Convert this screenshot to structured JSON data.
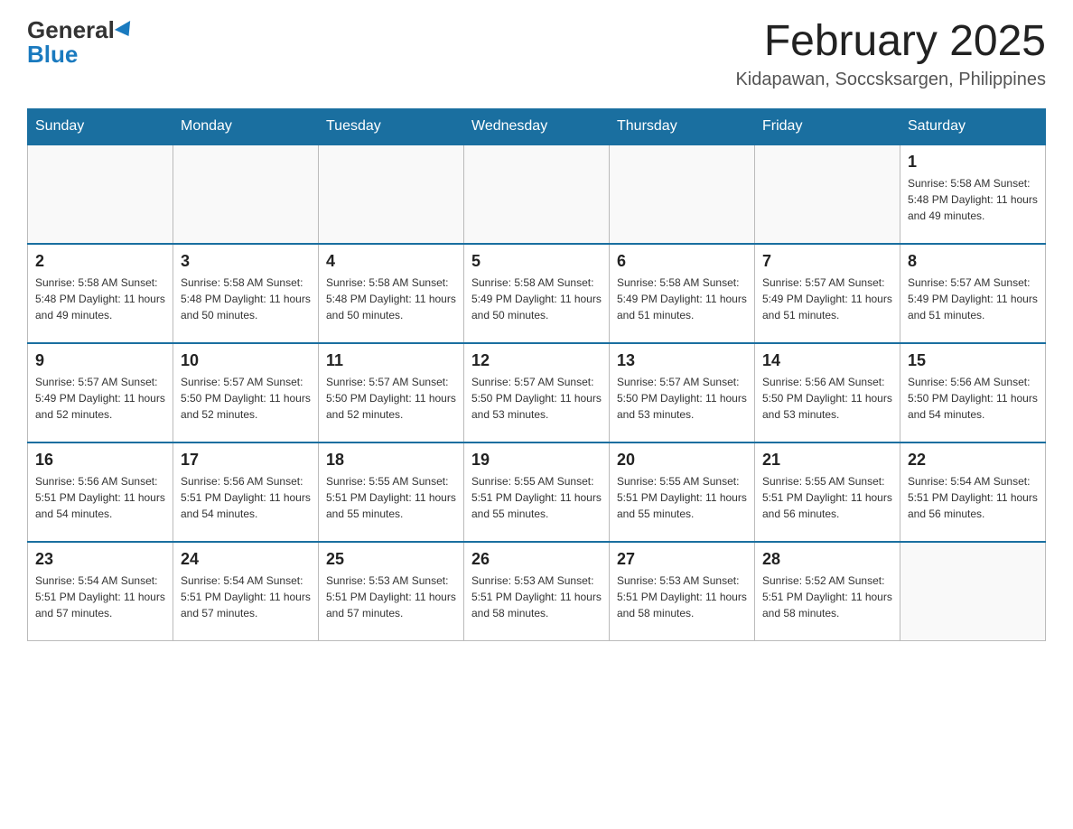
{
  "header": {
    "logo_general": "General",
    "logo_blue": "Blue",
    "month_year": "February 2025",
    "location": "Kidapawan, Soccsksargen, Philippines"
  },
  "days_of_week": [
    "Sunday",
    "Monday",
    "Tuesday",
    "Wednesday",
    "Thursday",
    "Friday",
    "Saturday"
  ],
  "weeks": [
    [
      {
        "day": "",
        "info": ""
      },
      {
        "day": "",
        "info": ""
      },
      {
        "day": "",
        "info": ""
      },
      {
        "day": "",
        "info": ""
      },
      {
        "day": "",
        "info": ""
      },
      {
        "day": "",
        "info": ""
      },
      {
        "day": "1",
        "info": "Sunrise: 5:58 AM\nSunset: 5:48 PM\nDaylight: 11 hours\nand 49 minutes."
      }
    ],
    [
      {
        "day": "2",
        "info": "Sunrise: 5:58 AM\nSunset: 5:48 PM\nDaylight: 11 hours\nand 49 minutes."
      },
      {
        "day": "3",
        "info": "Sunrise: 5:58 AM\nSunset: 5:48 PM\nDaylight: 11 hours\nand 50 minutes."
      },
      {
        "day": "4",
        "info": "Sunrise: 5:58 AM\nSunset: 5:48 PM\nDaylight: 11 hours\nand 50 minutes."
      },
      {
        "day": "5",
        "info": "Sunrise: 5:58 AM\nSunset: 5:49 PM\nDaylight: 11 hours\nand 50 minutes."
      },
      {
        "day": "6",
        "info": "Sunrise: 5:58 AM\nSunset: 5:49 PM\nDaylight: 11 hours\nand 51 minutes."
      },
      {
        "day": "7",
        "info": "Sunrise: 5:57 AM\nSunset: 5:49 PM\nDaylight: 11 hours\nand 51 minutes."
      },
      {
        "day": "8",
        "info": "Sunrise: 5:57 AM\nSunset: 5:49 PM\nDaylight: 11 hours\nand 51 minutes."
      }
    ],
    [
      {
        "day": "9",
        "info": "Sunrise: 5:57 AM\nSunset: 5:49 PM\nDaylight: 11 hours\nand 52 minutes."
      },
      {
        "day": "10",
        "info": "Sunrise: 5:57 AM\nSunset: 5:50 PM\nDaylight: 11 hours\nand 52 minutes."
      },
      {
        "day": "11",
        "info": "Sunrise: 5:57 AM\nSunset: 5:50 PM\nDaylight: 11 hours\nand 52 minutes."
      },
      {
        "day": "12",
        "info": "Sunrise: 5:57 AM\nSunset: 5:50 PM\nDaylight: 11 hours\nand 53 minutes."
      },
      {
        "day": "13",
        "info": "Sunrise: 5:57 AM\nSunset: 5:50 PM\nDaylight: 11 hours\nand 53 minutes."
      },
      {
        "day": "14",
        "info": "Sunrise: 5:56 AM\nSunset: 5:50 PM\nDaylight: 11 hours\nand 53 minutes."
      },
      {
        "day": "15",
        "info": "Sunrise: 5:56 AM\nSunset: 5:50 PM\nDaylight: 11 hours\nand 54 minutes."
      }
    ],
    [
      {
        "day": "16",
        "info": "Sunrise: 5:56 AM\nSunset: 5:51 PM\nDaylight: 11 hours\nand 54 minutes."
      },
      {
        "day": "17",
        "info": "Sunrise: 5:56 AM\nSunset: 5:51 PM\nDaylight: 11 hours\nand 54 minutes."
      },
      {
        "day": "18",
        "info": "Sunrise: 5:55 AM\nSunset: 5:51 PM\nDaylight: 11 hours\nand 55 minutes."
      },
      {
        "day": "19",
        "info": "Sunrise: 5:55 AM\nSunset: 5:51 PM\nDaylight: 11 hours\nand 55 minutes."
      },
      {
        "day": "20",
        "info": "Sunrise: 5:55 AM\nSunset: 5:51 PM\nDaylight: 11 hours\nand 55 minutes."
      },
      {
        "day": "21",
        "info": "Sunrise: 5:55 AM\nSunset: 5:51 PM\nDaylight: 11 hours\nand 56 minutes."
      },
      {
        "day": "22",
        "info": "Sunrise: 5:54 AM\nSunset: 5:51 PM\nDaylight: 11 hours\nand 56 minutes."
      }
    ],
    [
      {
        "day": "23",
        "info": "Sunrise: 5:54 AM\nSunset: 5:51 PM\nDaylight: 11 hours\nand 57 minutes."
      },
      {
        "day": "24",
        "info": "Sunrise: 5:54 AM\nSunset: 5:51 PM\nDaylight: 11 hours\nand 57 minutes."
      },
      {
        "day": "25",
        "info": "Sunrise: 5:53 AM\nSunset: 5:51 PM\nDaylight: 11 hours\nand 57 minutes."
      },
      {
        "day": "26",
        "info": "Sunrise: 5:53 AM\nSunset: 5:51 PM\nDaylight: 11 hours\nand 58 minutes."
      },
      {
        "day": "27",
        "info": "Sunrise: 5:53 AM\nSunset: 5:51 PM\nDaylight: 11 hours\nand 58 minutes."
      },
      {
        "day": "28",
        "info": "Sunrise: 5:52 AM\nSunset: 5:51 PM\nDaylight: 11 hours\nand 58 minutes."
      },
      {
        "day": "",
        "info": ""
      }
    ]
  ]
}
